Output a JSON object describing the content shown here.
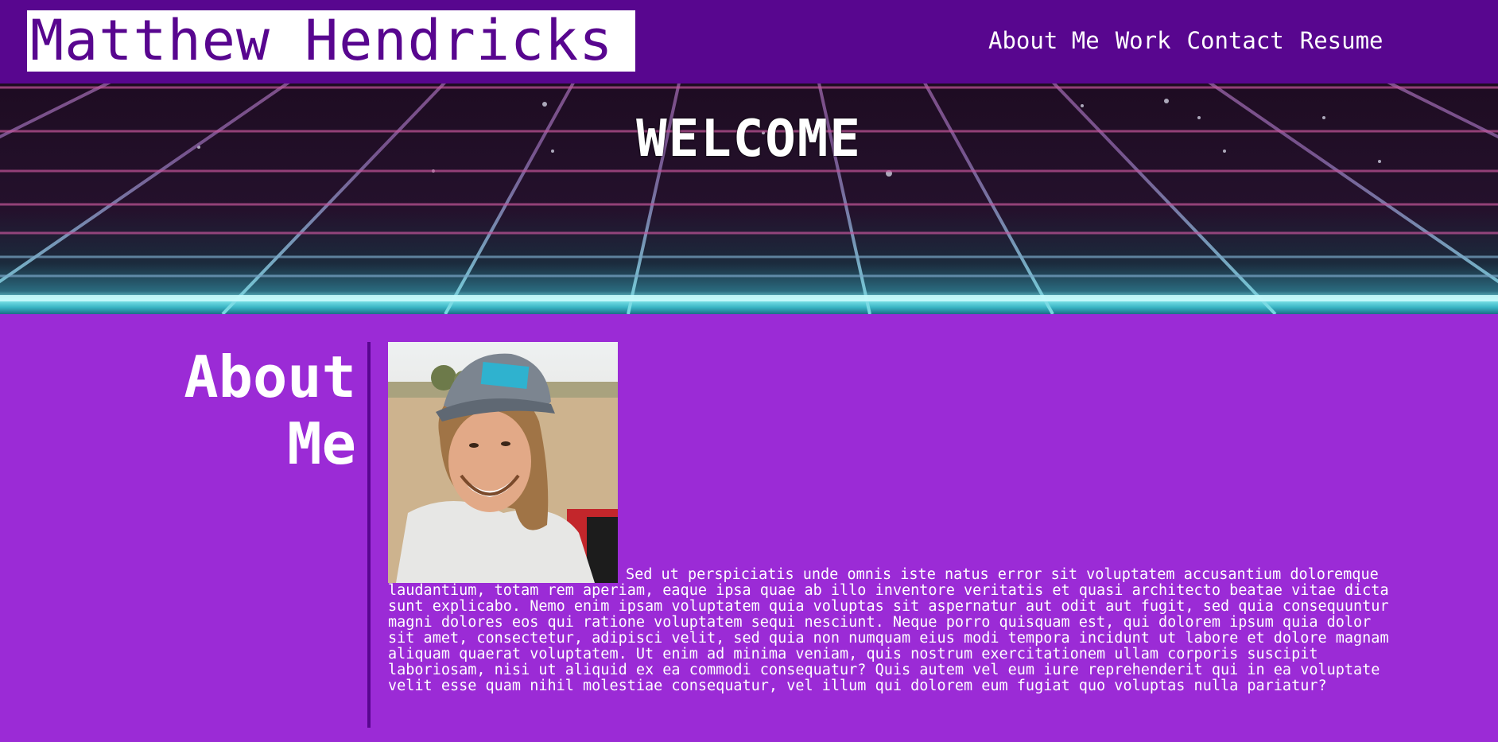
{
  "header": {
    "name": "Matthew Hendricks",
    "nav": [
      "About Me",
      "Work",
      "Contact",
      "Resume"
    ]
  },
  "hero": {
    "title": "WELCOME"
  },
  "about": {
    "heading": "About Me",
    "photo_icon": "portrait-photo",
    "text": "Sed ut perspiciatis unde omnis iste natus error sit voluptatem accusantium doloremque laudantium, totam rem aperiam, eaque ipsa quae ab illo inventore veritatis et quasi architecto beatae vitae dicta sunt explicabo. Nemo enim ipsam voluptatem quia voluptas sit aspernatur aut odit aut fugit, sed quia consequuntur magni dolores eos qui ratione voluptatem sequi nesciunt. Neque porro quisquam est, qui dolorem ipsum quia dolor sit amet, consectetur, adipisci velit, sed quia non numquam eius modi tempora incidunt ut labore et dolore magnam aliquam quaerat voluptatem. Ut enim ad minima veniam, quis nostrum exercitationem ullam corporis suscipit laboriosam, nisi ut aliquid ex ea commodi consequatur? Quis autem vel eum iure reprehenderit qui in ea voluptate velit esse quam nihil molestiae consequatur, vel illum qui dolorem eum fugiat quo voluptas nulla pariatur?"
  },
  "colors": {
    "header_bg": "#58068f",
    "page_bg": "#9b2bd6",
    "text": "#ffffff",
    "grid_pink": "#d8518f",
    "horizon_cyan": "#7ee4e9"
  }
}
